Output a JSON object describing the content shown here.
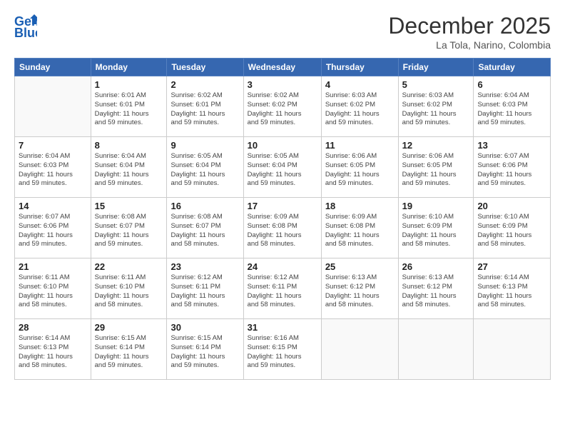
{
  "header": {
    "logo_line1": "General",
    "logo_line2": "Blue",
    "month": "December 2025",
    "location": "La Tola, Narino, Colombia"
  },
  "weekdays": [
    "Sunday",
    "Monday",
    "Tuesday",
    "Wednesday",
    "Thursday",
    "Friday",
    "Saturday"
  ],
  "weeks": [
    [
      {
        "day": "",
        "info": ""
      },
      {
        "day": "1",
        "info": "Sunrise: 6:01 AM\nSunset: 6:01 PM\nDaylight: 11 hours\nand 59 minutes."
      },
      {
        "day": "2",
        "info": "Sunrise: 6:02 AM\nSunset: 6:01 PM\nDaylight: 11 hours\nand 59 minutes."
      },
      {
        "day": "3",
        "info": "Sunrise: 6:02 AM\nSunset: 6:02 PM\nDaylight: 11 hours\nand 59 minutes."
      },
      {
        "day": "4",
        "info": "Sunrise: 6:03 AM\nSunset: 6:02 PM\nDaylight: 11 hours\nand 59 minutes."
      },
      {
        "day": "5",
        "info": "Sunrise: 6:03 AM\nSunset: 6:02 PM\nDaylight: 11 hours\nand 59 minutes."
      },
      {
        "day": "6",
        "info": "Sunrise: 6:04 AM\nSunset: 6:03 PM\nDaylight: 11 hours\nand 59 minutes."
      }
    ],
    [
      {
        "day": "7",
        "info": "Sunrise: 6:04 AM\nSunset: 6:03 PM\nDaylight: 11 hours\nand 59 minutes."
      },
      {
        "day": "8",
        "info": "Sunrise: 6:04 AM\nSunset: 6:04 PM\nDaylight: 11 hours\nand 59 minutes."
      },
      {
        "day": "9",
        "info": "Sunrise: 6:05 AM\nSunset: 6:04 PM\nDaylight: 11 hours\nand 59 minutes."
      },
      {
        "day": "10",
        "info": "Sunrise: 6:05 AM\nSunset: 6:04 PM\nDaylight: 11 hours\nand 59 minutes."
      },
      {
        "day": "11",
        "info": "Sunrise: 6:06 AM\nSunset: 6:05 PM\nDaylight: 11 hours\nand 59 minutes."
      },
      {
        "day": "12",
        "info": "Sunrise: 6:06 AM\nSunset: 6:05 PM\nDaylight: 11 hours\nand 59 minutes."
      },
      {
        "day": "13",
        "info": "Sunrise: 6:07 AM\nSunset: 6:06 PM\nDaylight: 11 hours\nand 59 minutes."
      }
    ],
    [
      {
        "day": "14",
        "info": "Sunrise: 6:07 AM\nSunset: 6:06 PM\nDaylight: 11 hours\nand 59 minutes."
      },
      {
        "day": "15",
        "info": "Sunrise: 6:08 AM\nSunset: 6:07 PM\nDaylight: 11 hours\nand 59 minutes."
      },
      {
        "day": "16",
        "info": "Sunrise: 6:08 AM\nSunset: 6:07 PM\nDaylight: 11 hours\nand 58 minutes."
      },
      {
        "day": "17",
        "info": "Sunrise: 6:09 AM\nSunset: 6:08 PM\nDaylight: 11 hours\nand 58 minutes."
      },
      {
        "day": "18",
        "info": "Sunrise: 6:09 AM\nSunset: 6:08 PM\nDaylight: 11 hours\nand 58 minutes."
      },
      {
        "day": "19",
        "info": "Sunrise: 6:10 AM\nSunset: 6:09 PM\nDaylight: 11 hours\nand 58 minutes."
      },
      {
        "day": "20",
        "info": "Sunrise: 6:10 AM\nSunset: 6:09 PM\nDaylight: 11 hours\nand 58 minutes."
      }
    ],
    [
      {
        "day": "21",
        "info": "Sunrise: 6:11 AM\nSunset: 6:10 PM\nDaylight: 11 hours\nand 58 minutes."
      },
      {
        "day": "22",
        "info": "Sunrise: 6:11 AM\nSunset: 6:10 PM\nDaylight: 11 hours\nand 58 minutes."
      },
      {
        "day": "23",
        "info": "Sunrise: 6:12 AM\nSunset: 6:11 PM\nDaylight: 11 hours\nand 58 minutes."
      },
      {
        "day": "24",
        "info": "Sunrise: 6:12 AM\nSunset: 6:11 PM\nDaylight: 11 hours\nand 58 minutes."
      },
      {
        "day": "25",
        "info": "Sunrise: 6:13 AM\nSunset: 6:12 PM\nDaylight: 11 hours\nand 58 minutes."
      },
      {
        "day": "26",
        "info": "Sunrise: 6:13 AM\nSunset: 6:12 PM\nDaylight: 11 hours\nand 58 minutes."
      },
      {
        "day": "27",
        "info": "Sunrise: 6:14 AM\nSunset: 6:13 PM\nDaylight: 11 hours\nand 58 minutes."
      }
    ],
    [
      {
        "day": "28",
        "info": "Sunrise: 6:14 AM\nSunset: 6:13 PM\nDaylight: 11 hours\nand 58 minutes."
      },
      {
        "day": "29",
        "info": "Sunrise: 6:15 AM\nSunset: 6:14 PM\nDaylight: 11 hours\nand 59 minutes."
      },
      {
        "day": "30",
        "info": "Sunrise: 6:15 AM\nSunset: 6:14 PM\nDaylight: 11 hours\nand 59 minutes."
      },
      {
        "day": "31",
        "info": "Sunrise: 6:16 AM\nSunset: 6:15 PM\nDaylight: 11 hours\nand 59 minutes."
      },
      {
        "day": "",
        "info": ""
      },
      {
        "day": "",
        "info": ""
      },
      {
        "day": "",
        "info": ""
      }
    ]
  ]
}
